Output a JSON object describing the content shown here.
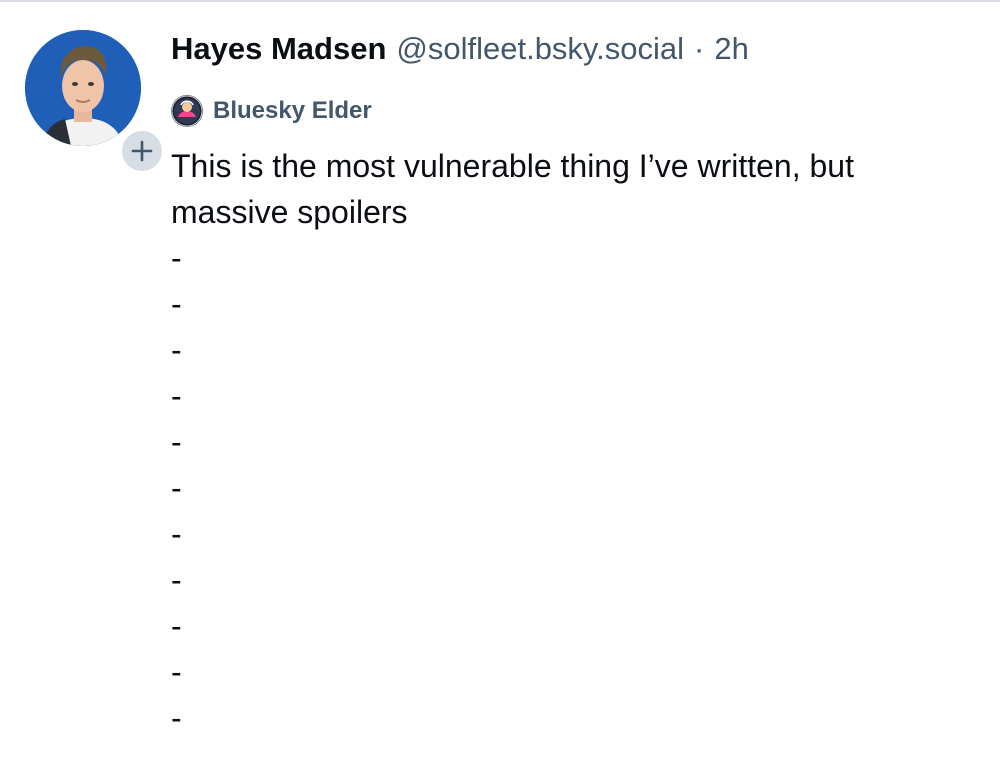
{
  "post": {
    "author": {
      "display_name": "Hayes Madsen",
      "handle": "@solfleet.bsky.social",
      "avatar_icon": "user-avatar"
    },
    "separator": "·",
    "timestamp": "2h",
    "follow_icon": "plus-icon",
    "badge": {
      "icon": "badge-avatar-icon",
      "label": "Bluesky Elder"
    },
    "text_lines": [
      "This is the most vulnerable thing I’ve written, but",
      "massive spoilers",
      "-",
      "-",
      "-",
      "-",
      "-",
      "-",
      "-",
      "-",
      "-",
      "-",
      "-"
    ]
  },
  "colors": {
    "text_primary": "#0b0f14",
    "text_secondary": "#42576c",
    "follow_button_bg": "#d6dde5",
    "divider": "#d9dee4",
    "avatar_bg": "#1f5fb7"
  }
}
